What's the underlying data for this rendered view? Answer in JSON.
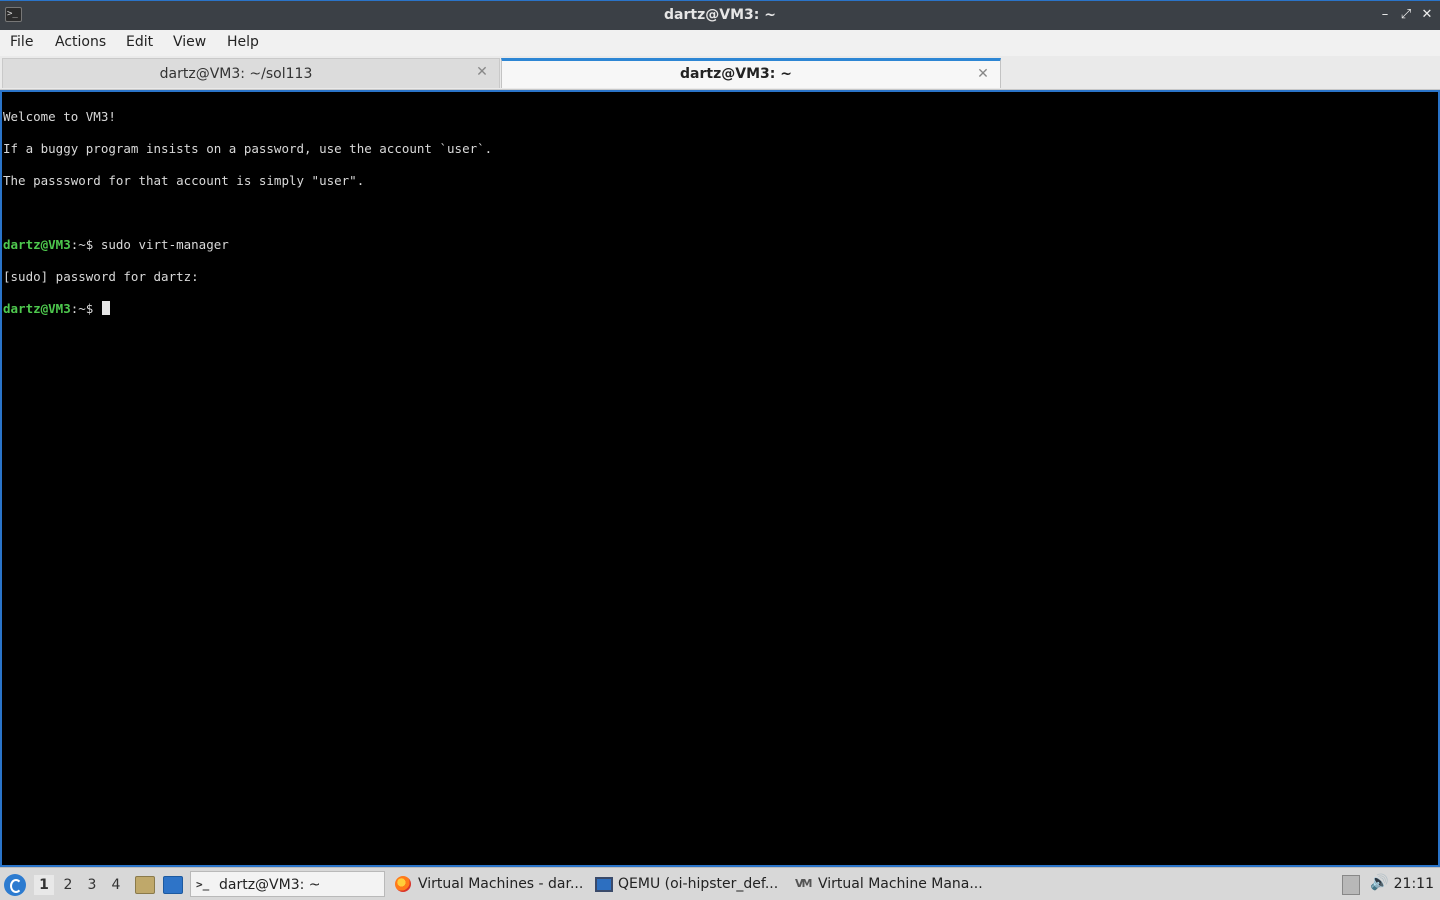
{
  "window": {
    "title": "dartz@VM3: ~",
    "minimize": "–",
    "maximize": "⤢",
    "close": "✕"
  },
  "menubar": [
    "File",
    "Actions",
    "Edit",
    "View",
    "Help"
  ],
  "tabs": [
    {
      "label": "dartz@VM3: ~/sol113",
      "active": false
    },
    {
      "label": "dartz@VM3: ~",
      "active": true
    }
  ],
  "terminal": {
    "motd": [
      "Welcome to VM3!",
      "If a buggy program insists on a password, use the account `user`.",
      "The passsword for that account is simply \"user\"."
    ],
    "prompt_user": "dartz@VM3",
    "prompt_sep": ":~$ ",
    "command": "sudo virt-manager",
    "sudo_prompt": "[sudo] password for dartz:"
  },
  "taskbar": {
    "workspaces": [
      "1",
      "2",
      "3",
      "4"
    ],
    "active_workspace": "1",
    "tasks": [
      {
        "label": "dartz@VM3: ~",
        "icon": "terminal-icon",
        "active": true
      },
      {
        "label": "Virtual Machines - dar...",
        "icon": "firefox-icon",
        "active": false
      },
      {
        "label": "QEMU (oi-hipster_def...",
        "icon": "monitor-icon",
        "active": false
      },
      {
        "label": "Virtual Machine Mana...",
        "icon": "virt-manager-icon",
        "active": false
      }
    ],
    "clock": "21:11"
  },
  "colors": {
    "accent": "#2a74c9",
    "prompt": "#4ec94e",
    "terminal_bg": "#000000",
    "terminal_fg": "#d9d9d9"
  }
}
